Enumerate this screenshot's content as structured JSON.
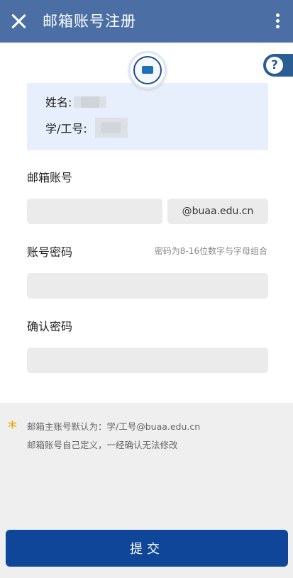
{
  "header": {
    "title": "邮箱账号注册",
    "close_icon": "close-icon",
    "more_icon": "more-vertical-icon",
    "bg_color": "#4b6fa5"
  },
  "help": {
    "symbol": "?",
    "icon": "help-icon"
  },
  "user_info": {
    "name_label": "姓名:",
    "id_label": "学/工号:"
  },
  "email": {
    "label": "邮箱账号",
    "value": "",
    "domain": "@buaa.edu.cn"
  },
  "password": {
    "label": "账号密码",
    "hint": "密码为8-16位数字与字母组合",
    "value": ""
  },
  "confirm": {
    "label": "确认密码",
    "value": ""
  },
  "notes": {
    "line1": "邮箱主账号默认为：学/工号@buaa.edu.cn",
    "line2": "邮箱账号自己定义，一经确认无法修改",
    "star": "*",
    "star_color": "#f0a30a"
  },
  "submit": {
    "label": "提交",
    "color": "#0f4699"
  }
}
